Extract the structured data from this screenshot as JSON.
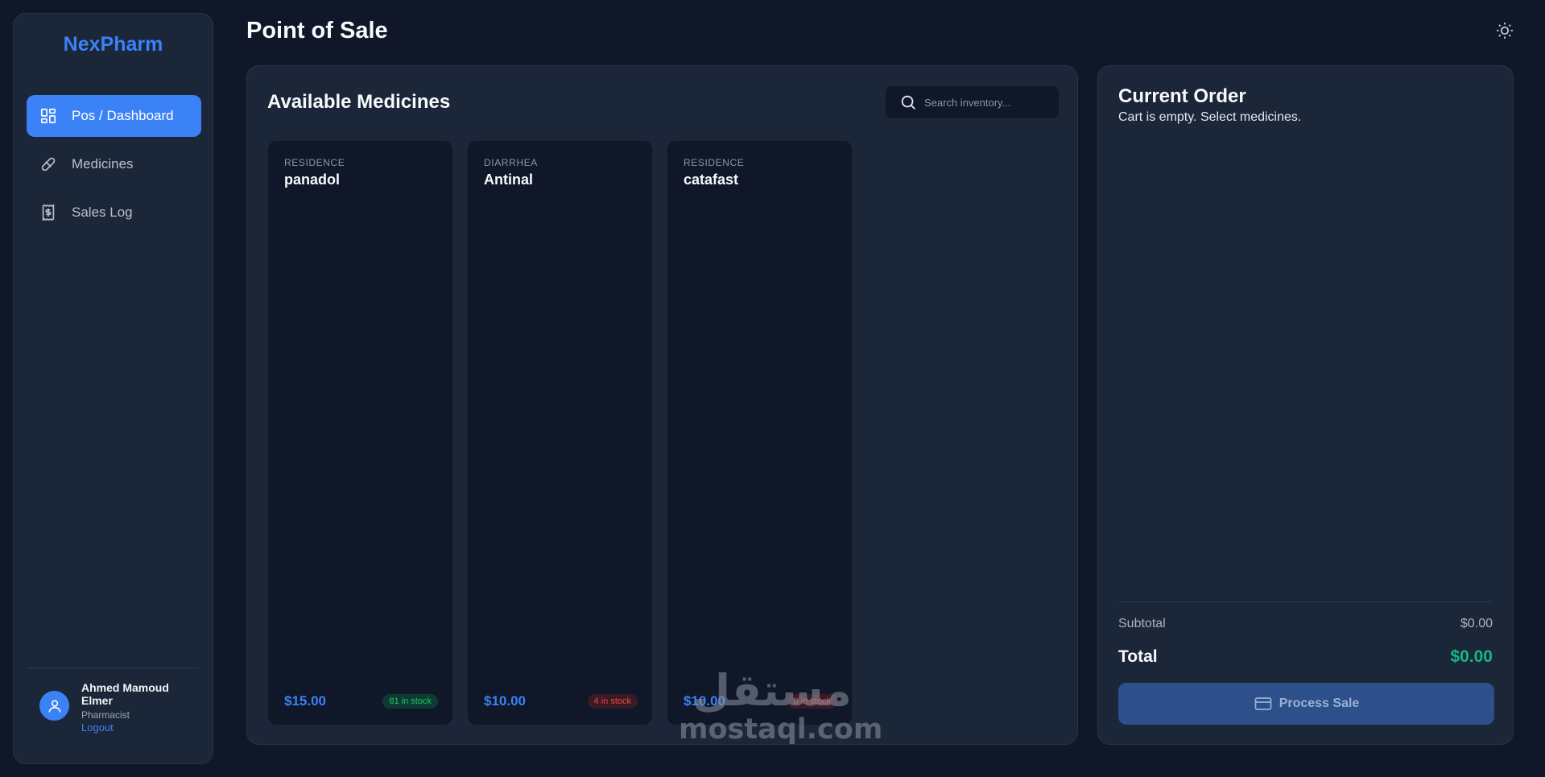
{
  "brand": {
    "name": "NexPharm"
  },
  "nav": {
    "items": [
      {
        "label": "Pos / Dashboard",
        "icon": "dashboard-grid-icon",
        "active": true
      },
      {
        "label": "Medicines",
        "icon": "pill-icon",
        "active": false
      },
      {
        "label": "Sales Log",
        "icon": "receipt-dollar-icon",
        "active": false
      }
    ]
  },
  "user": {
    "name": "Ahmed Mamoud Elmer",
    "role": "Pharmacist",
    "logout_label": "Logout"
  },
  "header": {
    "title": "Point of Sale",
    "theme_icon": "sun-icon"
  },
  "medicines": {
    "title": "Available Medicines",
    "search": {
      "placeholder": "Search inventory...",
      "value": ""
    },
    "cards": [
      {
        "category": "RESIDENCE",
        "name": "panadol",
        "price": "$15.00",
        "stock": "81 in stock"
      },
      {
        "category": "DIARRHEA",
        "name": "Antinal",
        "price": "$10.00",
        "stock": "4 in stock"
      },
      {
        "category": "RESIDENCE",
        "name": "catafast",
        "price": "$10.00",
        "stock": "0 in stock"
      }
    ]
  },
  "order": {
    "title": "Current Order",
    "empty_message": "Cart is empty. Select medicines.",
    "subtotal_label": "Subtotal",
    "subtotal_value": "$0.00",
    "total_label": "Total",
    "total_value": "$0.00",
    "process_label": "Process Sale"
  },
  "watermark": {
    "arabic": "مستقل",
    "latin": "mostaql.com"
  },
  "colors": {
    "accent": "#3b82f6",
    "success": "#10b981",
    "danger": "#ef4444",
    "background": "#0f1729",
    "panel": "#1b2638"
  }
}
